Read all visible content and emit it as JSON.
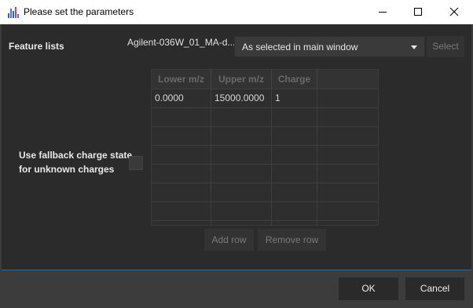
{
  "window": {
    "title": "Please set the parameters"
  },
  "params": {
    "feature_lists_label": "Feature lists",
    "feature_list_file": "Agilent-036W_01_MA-d...",
    "feature_list_mode": "As selected in main window",
    "select_button": "Select",
    "fallback_label_line1": "Use fallback charge state",
    "fallback_label_line2": "for unknown charges",
    "fallback_checked": false
  },
  "table": {
    "columns": [
      "Lower m/z",
      "Upper m/z",
      "Charge",
      ""
    ],
    "rows": [
      [
        "0.0000",
        "15000.0000",
        "1",
        ""
      ]
    ],
    "add_row_button": "Add row",
    "remove_row_button": "Remove row"
  },
  "footer": {
    "ok_button": "OK",
    "cancel_button": "Cancel"
  },
  "colors": {
    "title_bar": "#ffffff",
    "dialog_bg": "#2b2b2b",
    "window_bg": "#3c3c3c",
    "accent_border": "#1e6fa8"
  }
}
